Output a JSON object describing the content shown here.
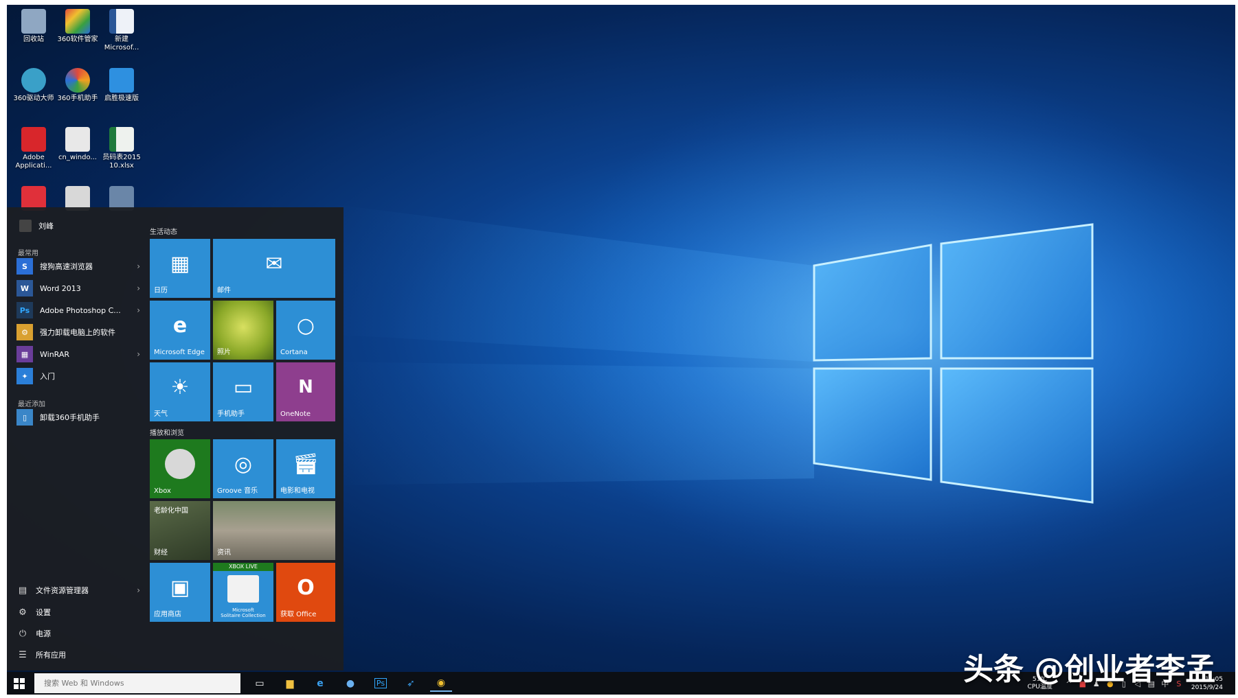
{
  "desktop": {
    "icons": [
      {
        "name": "recycle-bin-icon",
        "label": "回收站",
        "color": "#8fa7c2"
      },
      {
        "name": "software-manager-icon",
        "label": "360软件管家",
        "color": "#e04a3c"
      },
      {
        "name": "word-doc-icon",
        "label": "新建\nMicrosof...",
        "color": "#e8eef7"
      },
      {
        "name": "driver-master-icon",
        "label": "360驱动大师",
        "color": "#3aa0c8"
      },
      {
        "name": "phone-helper-icon",
        "label": "360手机助手",
        "color": "#f0a020"
      },
      {
        "name": "qifeng-bird-icon",
        "label": "启胜极速版",
        "color": "#2e90e0"
      },
      {
        "name": "adobe-icon",
        "label": "Adobe\nApplicati...",
        "color": "#d8262b"
      },
      {
        "name": "cn-windows-file-icon",
        "label": "cn_windo...",
        "color": "#e8e8e8"
      },
      {
        "name": "excel-file-icon",
        "label": "员码表2015\n10.xlsx",
        "color": "#1f7a3c"
      },
      {
        "name": "red-app-icon",
        "label": "",
        "color": "#e0303a"
      },
      {
        "name": "white-app-icon",
        "label": "",
        "color": "#d8d8d8"
      },
      {
        "name": "game-app-icon",
        "label": "",
        "color": "#6a86a8"
      }
    ]
  },
  "start": {
    "user_name": "刘峰",
    "most_used_heading": "最常用",
    "recent_heading": "最近添加",
    "apps": [
      {
        "name": "sogou-browser",
        "label": "搜狗高速浏览器",
        "glyph": "S",
        "color": "#2b6fd6",
        "chevron": true
      },
      {
        "name": "word-2013",
        "label": "Word 2013",
        "glyph": "W",
        "color": "#2b5797",
        "chevron": true
      },
      {
        "name": "adobe-photoshop",
        "label": "Adobe Photoshop C...",
        "glyph": "Ps",
        "color": "#1e3a5a",
        "chevron": true
      },
      {
        "name": "pc-helper",
        "label": "强力卸载电脑上的软件",
        "glyph": "⚙",
        "color": "#d9a030",
        "chevron": false
      },
      {
        "name": "winrar",
        "label": "WinRAR",
        "glyph": "▦",
        "color": "#6a3d9a",
        "chevron": true
      },
      {
        "name": "intro",
        "label": "入门",
        "glyph": "💡",
        "color": "#2b7fd8",
        "chevron": false
      }
    ],
    "recent_apps": [
      {
        "name": "phone-helper",
        "label": "卸载360手机助手",
        "glyph": "▯",
        "color": "#3a86c8"
      }
    ],
    "bottom": {
      "file_explorer": "文件资源管理器",
      "settings": "设置",
      "power": "电源",
      "all_apps": "所有应用"
    },
    "groups": {
      "life": "生活动态",
      "play": "播放和浏览"
    },
    "tiles": {
      "calendar": "日历",
      "mail": "邮件",
      "edge": "Microsoft Edge",
      "photos": "照片",
      "cortana": "Cortana",
      "weather": "天气",
      "phone": "手机助手",
      "onenote": "OneNote",
      "xbox": "Xbox",
      "groove": "Groove 音乐",
      "movies": "电影和电视",
      "finance_headline": "老龄化中国",
      "finance": "财经",
      "news": "资讯",
      "store": "应用商店",
      "xbox_live": "XBOX LIVE",
      "solitaire": "Microsoft\nSolitaire Collection",
      "office": "获取 Office"
    }
  },
  "taskbar": {
    "search_placeholder": "搜索 Web 和 Windows",
    "cpu_temp": "51℃",
    "cpu_label": "CPU温度",
    "time": "11:05",
    "date": "2015/9/24",
    "ime": "中"
  },
  "watermark": "头条 @创业者李孟",
  "colors": {
    "tile_blue": "#2d8fd5",
    "tile_purple": "#8e3e8e",
    "tile_green": "#1e7a1e",
    "tile_orange": "#e0490f"
  }
}
